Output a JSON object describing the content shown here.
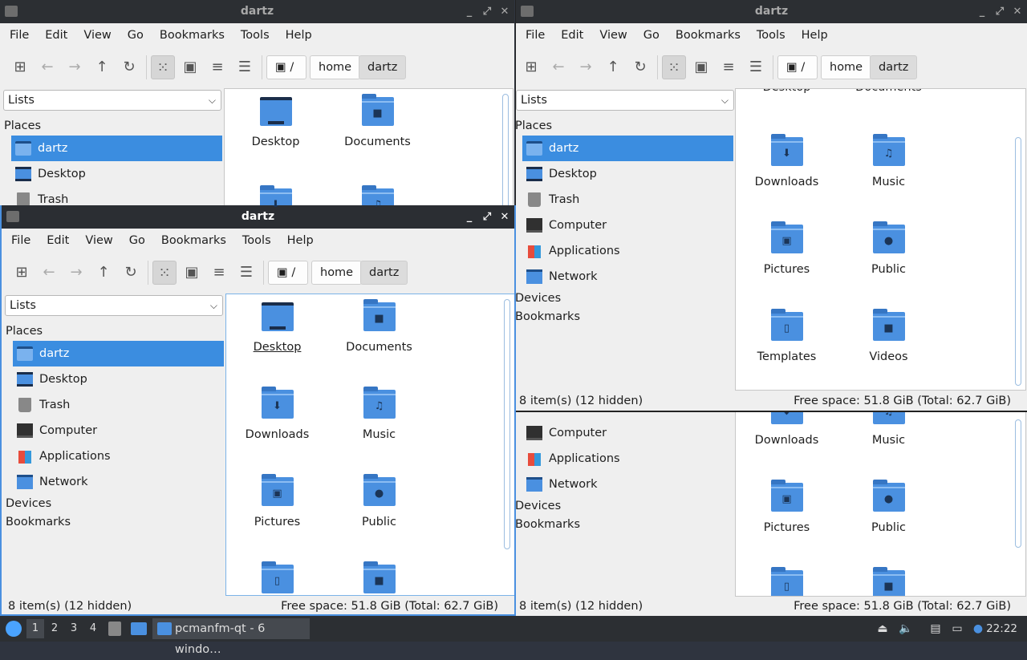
{
  "win_title": "dartz",
  "menu": [
    "File",
    "Edit",
    "View",
    "Go",
    "Bookmarks",
    "Tools",
    "Help"
  ],
  "crumbs": [
    "/",
    "home",
    "dartz"
  ],
  "side_mode": "Lists",
  "places_label": "Places",
  "places": [
    "dartz",
    "Desktop",
    "Trash",
    "Computer",
    "Applications",
    "Network"
  ],
  "devices_label": "Devices",
  "bookmarks_label": "Bookmarks",
  "files": [
    "Desktop",
    "Documents",
    "Downloads",
    "Music",
    "Pictures",
    "Public",
    "Templates",
    "Videos"
  ],
  "status_left": "8 item(s) (12 hidden)",
  "status_right": "Free space: 51.8 GiB (Total: 62.7 GiB)",
  "taskbar": {
    "workspaces": [
      "1",
      "2",
      "3",
      "4"
    ],
    "task": "pcmanfm-qt - 6 windo…",
    "clock": "22:22"
  },
  "colors": {
    "accent": "#3b8de0",
    "folder": "#4a90e0"
  }
}
